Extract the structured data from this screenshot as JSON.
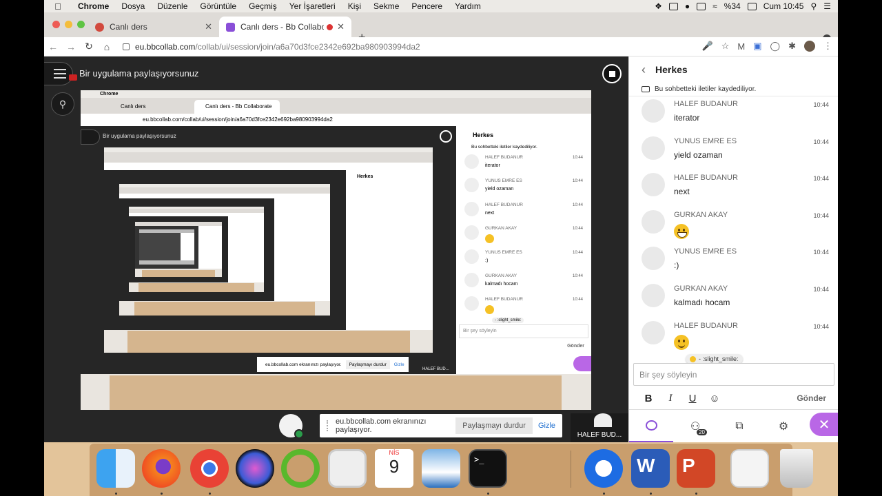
{
  "menubar": {
    "app": "Chrome",
    "items": [
      "Dosya",
      "Düzenle",
      "Görüntüle",
      "Geçmiş",
      "Yer İşaretleri",
      "Kişi",
      "Sekme",
      "Pencere",
      "Yardım"
    ],
    "battery": "%34",
    "clock": "Cum 10:45"
  },
  "tabs": [
    {
      "title": "Canlı ders",
      "active": false
    },
    {
      "title": "Canlı ders - Bb Collaborate",
      "active": true
    }
  ],
  "url": {
    "host": "eu.bbcollab.com",
    "path": "/collab/ui/session/join/a6a70d3fce2342e692ba980903994da2"
  },
  "session": {
    "share_status": "Bir uygulama paylaşıyorsunuz",
    "share_bar": {
      "text": "eu.bbcollab.com ekranınızı paylaşıyor.",
      "stop": "Paylaşmayı durdur",
      "hide": "Gizle"
    },
    "presenter_tile": "HALEF BUD..."
  },
  "chat": {
    "title": "Herkes",
    "notice": "Bu sohbetteki iletiler kaydediliyor.",
    "messages": [
      {
        "name": "HALEF BUDANUR",
        "time": "10:44",
        "text": "iterator",
        "emoji": ""
      },
      {
        "name": "YUNUS EMRE ES",
        "time": "10:44",
        "text": "yield ozaman",
        "emoji": ""
      },
      {
        "name": "HALEF BUDANUR",
        "time": "10:44",
        "text": "next",
        "emoji": ""
      },
      {
        "name": "GURKAN AKAY",
        "time": "10:44",
        "text": "",
        "emoji": "grin"
      },
      {
        "name": "YUNUS EMRE ES",
        "time": "10:44",
        "text": ":)",
        "emoji": ""
      },
      {
        "name": "GURKAN AKAY",
        "time": "10:44",
        "text": "kalmadı hocam",
        "emoji": ""
      },
      {
        "name": "HALEF BUDANUR",
        "time": "10:44",
        "text": "",
        "emoji": "smile"
      }
    ],
    "emoji_tooltip": "- :slight_smile:",
    "composer_placeholder": "Bir şey söyleyin",
    "format": {
      "bold": "B",
      "italic": "I",
      "underline": "U",
      "send": "Gönder"
    },
    "participants_count": "20",
    "accent": "#8a4fd8"
  },
  "nested_share": {
    "menu_app": "Chrome",
    "tab_inactive": "Canlı ders",
    "tab_active": "Canlı ders - Bb Collaborate",
    "url": "eu.bbcollab.com/collab/ui/session/join/a6a70d3fce2342e692ba980903994da2",
    "share_status": "Bir uygulama paylaşıyorsunuz",
    "chat_title": "Herkes",
    "notice": "Bu sohbetteki iletiler kaydediliyor.",
    "messages": [
      {
        "name": "HALEF BUDANUR",
        "time": "10:44",
        "text": "iterator"
      },
      {
        "name": "YUNUS EMRE ES",
        "time": "10:44",
        "text": "yield ozaman"
      },
      {
        "name": "HALEF BUDANUR",
        "time": "10:44",
        "text": "next"
      },
      {
        "name": "GURKAN AKAY",
        "time": "10:44",
        "text": ""
      },
      {
        "name": "YUNUS EMRE ES",
        "time": "10:44",
        "text": ":)"
      },
      {
        "name": "GURKAN AKAY",
        "time": "10:44",
        "text": "kalmadı hocam"
      },
      {
        "name": "HALEF BUDANUR",
        "time": "10:44",
        "text": ""
      }
    ],
    "emoji_tooltip": "- :slight_smile:",
    "composer_placeholder": "Bir şey söyleyin",
    "send": "Gönder",
    "share_bar_text": "eu.bbcollab.com ekranınızı paylaşıyor.",
    "share_bar_stop": "Paylaşmayı durdur",
    "share_bar_hide": "Gizle",
    "presenter_tile": "HALEF BUD..."
  },
  "dock": {
    "calendar_month": "NİS",
    "calendar_day": "9",
    "icons": [
      "finder-icon",
      "firefox-icon",
      "chrome-icon",
      "siri-icon",
      "circle-app-icon",
      "preview-icon",
      "calendar-icon",
      "photos-icon",
      "terminal-icon",
      "teamviewer-icon",
      "word-icon",
      "powerpoint-icon",
      "desktop-folder-icon",
      "trash-icon"
    ]
  }
}
